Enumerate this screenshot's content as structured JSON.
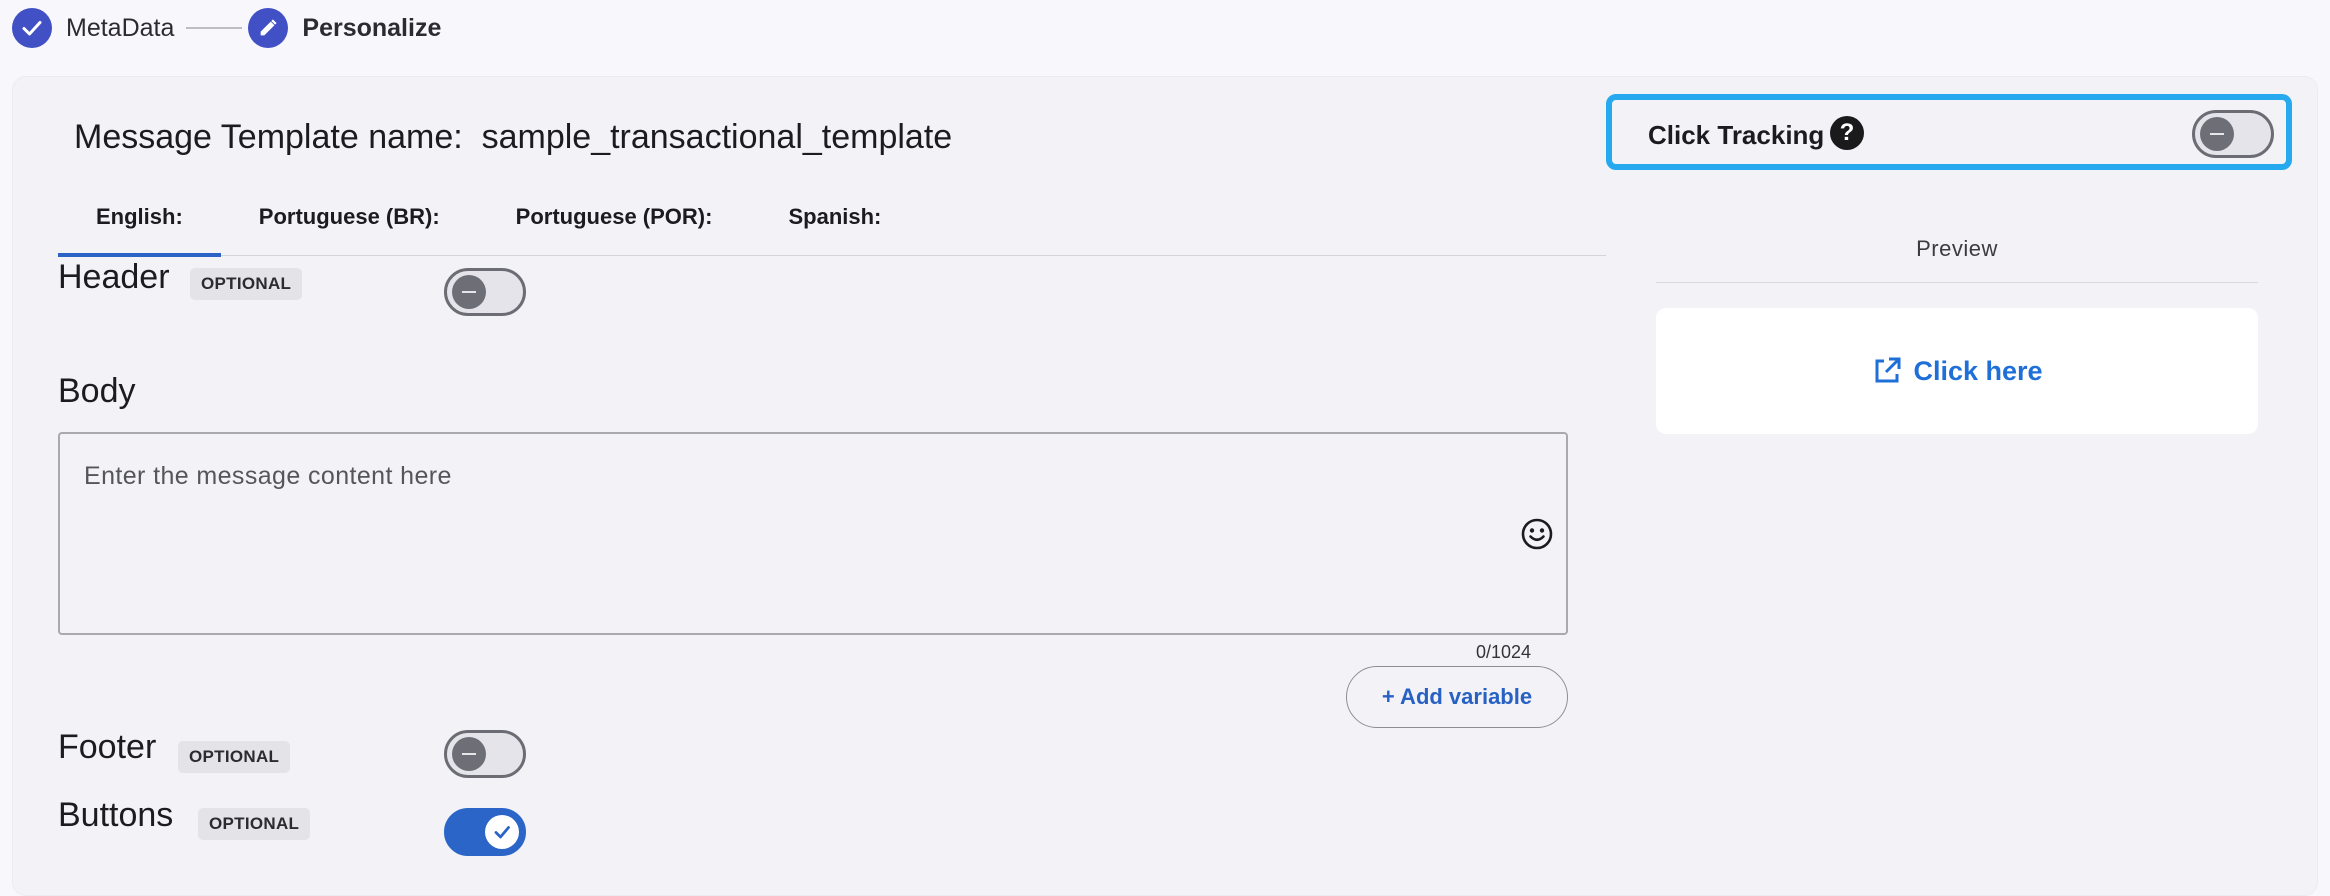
{
  "stepper": {
    "step1_label": "MetaData",
    "step2_label": "Personalize"
  },
  "template": {
    "title": "Message Template name:  sample_transactional_template"
  },
  "tabs": [
    {
      "label": "English:",
      "active": true
    },
    {
      "label": "Portuguese (BR):",
      "active": false
    },
    {
      "label": "Portuguese (POR):",
      "active": false
    },
    {
      "label": "Spanish:",
      "active": false
    }
  ],
  "header": {
    "label": "Header",
    "badge": "OPTIONAL",
    "enabled": false
  },
  "body": {
    "label": "Body",
    "placeholder": "Enter the message content here",
    "counter": "0/1024",
    "add_variable": "+ Add variable"
  },
  "footer": {
    "label": "Footer",
    "badge": "OPTIONAL",
    "enabled": false
  },
  "buttons": {
    "label": "Buttons",
    "badge": "OPTIONAL",
    "enabled": true
  },
  "click_tracking": {
    "label": "Click Tracking",
    "help": "?",
    "enabled": false
  },
  "preview": {
    "label": "Preview",
    "link_text": "Click here"
  },
  "colors": {
    "accent": "#2a65c7",
    "step": "#4150c4",
    "highlight": "#26a9ef",
    "link": "#1f6fd8"
  }
}
